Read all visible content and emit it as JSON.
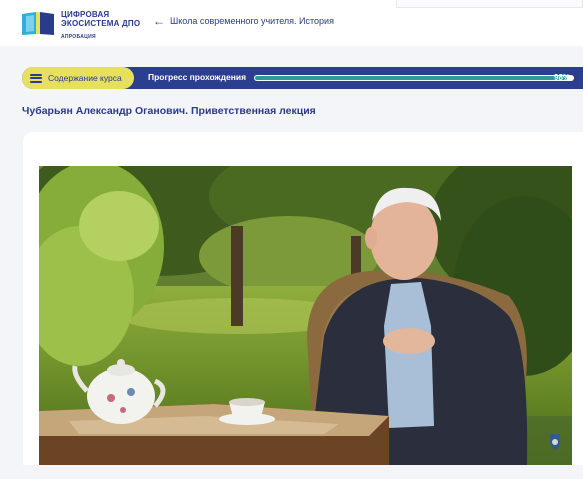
{
  "header": {
    "logo_line1": "ЦИФРОВАЯ",
    "logo_line2": "ЭКОСИСТЕМА ДПО",
    "logo_sub": "АПРОБАЦИЯ",
    "back_link": "Школа современного учителя. История"
  },
  "progress": {
    "contents_label": "Содержание курса",
    "label": "Прогресс прохождения",
    "value": 98,
    "percent_text": "98%"
  },
  "lecture": {
    "title": "Чубарьян Александр Оганович. Приветственная лекция"
  },
  "colors": {
    "brand": "#2a3a8c",
    "bar": "#2c3f8f",
    "accent": "#e7e05f",
    "fill": "#2c9b9b"
  }
}
